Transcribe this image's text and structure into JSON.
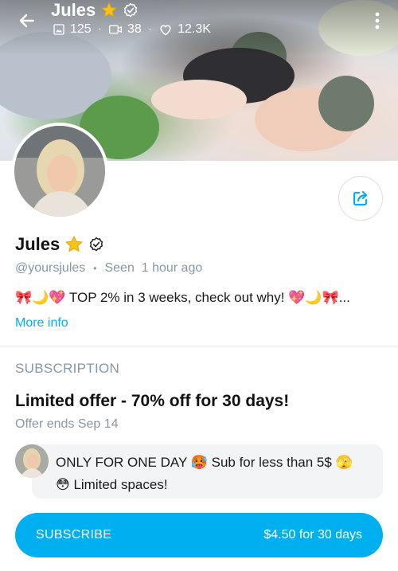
{
  "header": {
    "name": "Jules",
    "stats": [
      {
        "icon": "image-icon",
        "value": "125"
      },
      {
        "icon": "video-icon",
        "value": "38"
      },
      {
        "icon": "heart-icon",
        "value": "12.3K"
      }
    ]
  },
  "profile": {
    "name": "Jules",
    "handle": "@yoursjules",
    "separator": "•",
    "last_seen": "Seen  1 hour ago",
    "bio": "🎀🌙💖 TOP 2% in 3 weeks, check out why! 💖🌙🎀...",
    "more_info": "More info"
  },
  "subscription": {
    "heading": "SUBSCRIPTION",
    "offer_title": "Limited offer - 70% off for 30 days!",
    "offer_ends": "Offer ends Sep 14",
    "message_line1": "ONLY FOR ONE DAY 🥵 Sub for less than 5$ 🫣",
    "message_line2": "😳 Limited spaces!",
    "button_label": "SUBSCRIBE",
    "button_price": "$4.50 for 30 days"
  },
  "colors": {
    "accent": "#00aff0",
    "muted": "#8a96a3",
    "star": "#f7c21a"
  }
}
